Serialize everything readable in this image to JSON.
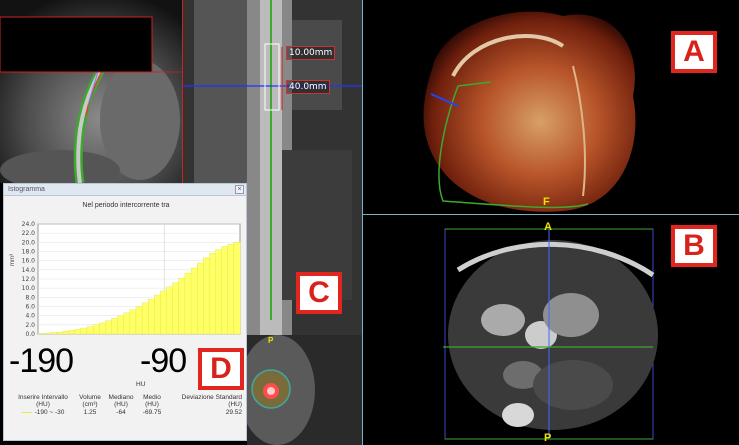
{
  "viewports": {
    "a": {
      "label": "A",
      "anchor_label": "F"
    },
    "b": {
      "label": "B",
      "top_label": "A",
      "bottom_label": "P"
    },
    "c": {
      "label": "C",
      "measure_top": "10.00mm",
      "measure_length": "40.0mm"
    },
    "d": {
      "label": "D",
      "top_label": "P"
    }
  },
  "histogram": {
    "window_title": "Istogramma",
    "title": "Nel periodo intercorrente tra",
    "ylabel": "mm³",
    "xlabel": "HU",
    "big_tick_left": "-190",
    "big_tick_right": "-90",
    "table": {
      "headers": [
        [
          "Inserire Intervallo",
          "(HU)"
        ],
        [
          "Volume",
          "(cm³)"
        ],
        [
          "Mediano",
          "(HU)"
        ],
        [
          "Medio",
          "(HU)"
        ],
        [
          "Deviazione Standard",
          "(HU)"
        ]
      ],
      "row": [
        "-190  ~  -30",
        "1.25",
        "-64",
        "-69.75",
        "29.52"
      ]
    }
  },
  "chart_data": {
    "type": "bar",
    "title": "Nel periodo intercorrente tra",
    "xlabel": "HU",
    "ylabel": "mm³",
    "xlim": [
      -190,
      -30
    ],
    "ylim": [
      0,
      24
    ],
    "yticks": [
      "0.0",
      "2.0",
      "4.0",
      "6.0",
      "8.0",
      "10.0",
      "12.0",
      "14.0",
      "16.0",
      "18.0",
      "20.0",
      "22.0",
      "24.0"
    ],
    "x": [
      -190,
      -185,
      -180,
      -175,
      -170,
      -165,
      -160,
      -155,
      -150,
      -145,
      -140,
      -135,
      -130,
      -125,
      -120,
      -115,
      -110,
      -105,
      -100,
      -95,
      -90,
      -85,
      -80,
      -75,
      -70,
      -65,
      -60,
      -55,
      -50,
      -45,
      -40,
      -35,
      -30
    ],
    "values": [
      0.1,
      0.2,
      0.3,
      0.4,
      0.6,
      0.8,
      1.0,
      1.3,
      1.6,
      2.0,
      2.4,
      2.9,
      3.4,
      4.0,
      4.6,
      5.3,
      6.0,
      6.8,
      7.6,
      8.5,
      9.4,
      10.3,
      11.2,
      12.2,
      13.3,
      14.4,
      15.5,
      16.6,
      17.6,
      18.4,
      19.1,
      19.6,
      20.0
    ],
    "colors": {
      "bars": "#ffff66",
      "bar_edge": "#d8d840"
    }
  }
}
